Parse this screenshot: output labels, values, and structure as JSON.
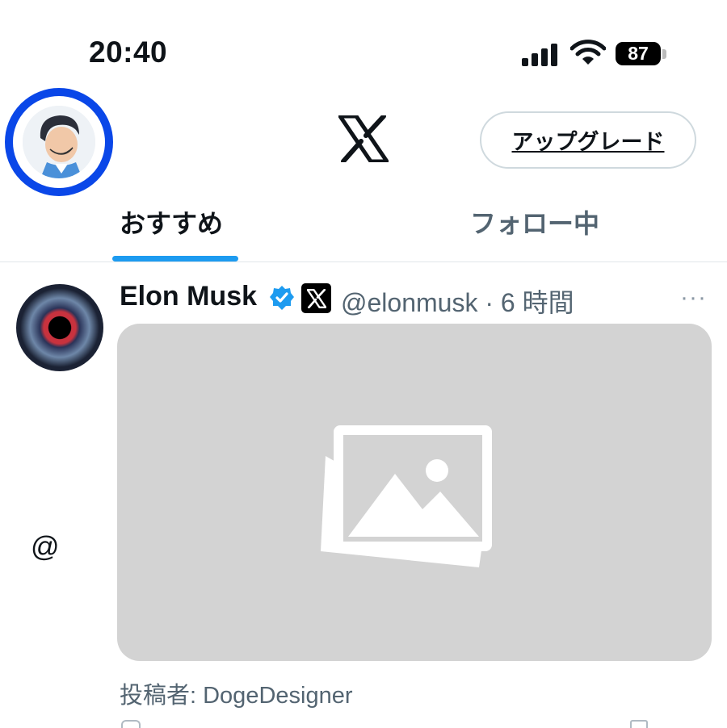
{
  "status_bar": {
    "time": "20:40",
    "battery": "87"
  },
  "header": {
    "logo": "x-logo-icon",
    "upgrade_label": "アップグレード"
  },
  "tabs": [
    {
      "label": "おすすめ",
      "active": true
    },
    {
      "label": "フォロー中",
      "active": false
    }
  ],
  "post": {
    "author_name": "Elon Musk",
    "handle_time": "@elonmusk · 6 時間",
    "more": "···",
    "mention_icon": "@",
    "posted_by": "投稿者: DogeDesigner",
    "media_icon": "image-placeholder-icon"
  },
  "colors": {
    "accent": "#1d9bf0",
    "ring": "#0a47e8",
    "secondary_text": "#536471",
    "media_bg": "#d3d3d3"
  }
}
